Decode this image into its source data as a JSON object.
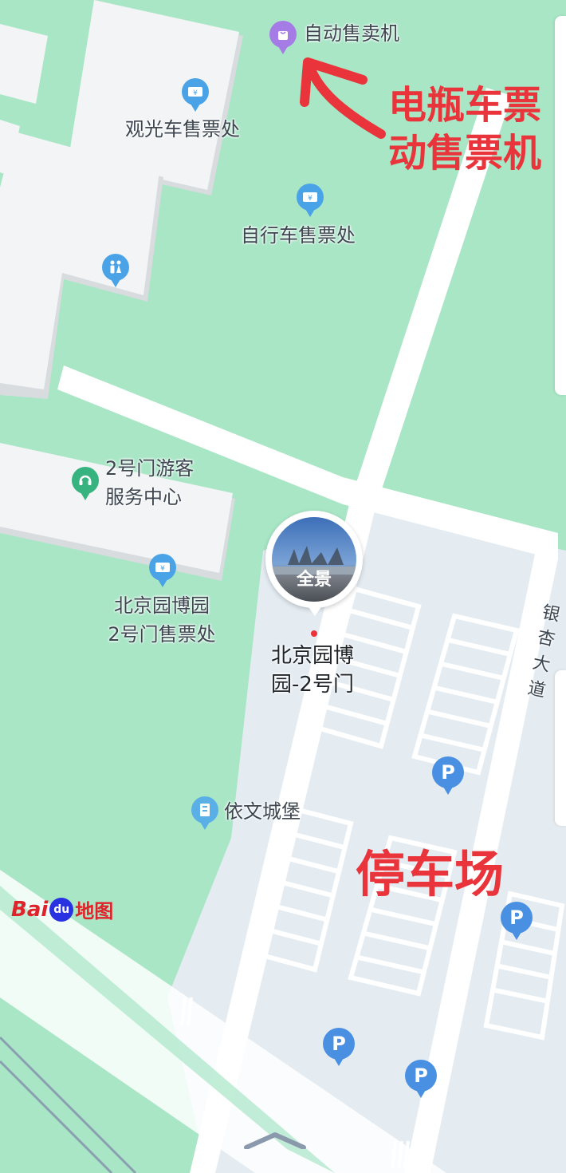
{
  "map": {
    "provider_logo": {
      "brand": "Bai",
      "paw": "du",
      "suffix": "地图"
    },
    "colors": {
      "grass": "#a8e6c6",
      "building": "#f2f4f6",
      "parking_area": "#e4ecf2",
      "road": "#ffffff",
      "annotation": "#e8343a"
    }
  },
  "pois": [
    {
      "id": "vending",
      "label": "自动售卖机",
      "icon": "shopping-bag-icon"
    },
    {
      "id": "sightseeing-ticket",
      "label": "观光车售票处",
      "icon": "ticket-icon"
    },
    {
      "id": "bicycle-ticket",
      "label": "自行车售票处",
      "icon": "ticket-icon"
    },
    {
      "id": "restroom",
      "label": "",
      "icon": "restroom-icon"
    },
    {
      "id": "visitor-center",
      "label_lines": [
        "2号门游客",
        "服务中心"
      ],
      "icon": "headset-icon"
    },
    {
      "id": "gate2-ticket",
      "label_lines": [
        "北京园博园",
        "2号门售票处"
      ],
      "icon": "ticket-icon"
    },
    {
      "id": "yiwen-castle",
      "label": "依文城堡",
      "icon": "building-icon"
    }
  ],
  "pano": {
    "badge": "全景",
    "title_lines": [
      "北京园博",
      "园-2号门"
    ]
  },
  "road_label": [
    "银",
    "杏",
    "大",
    "道"
  ],
  "parking_pins": [
    {
      "label": "P"
    },
    {
      "label": "P"
    },
    {
      "label": "P"
    },
    {
      "label": "P"
    }
  ],
  "annotations": {
    "ticket_machine_lines": [
      "电瓶车票",
      "动售票机"
    ],
    "parking": "停车场"
  }
}
